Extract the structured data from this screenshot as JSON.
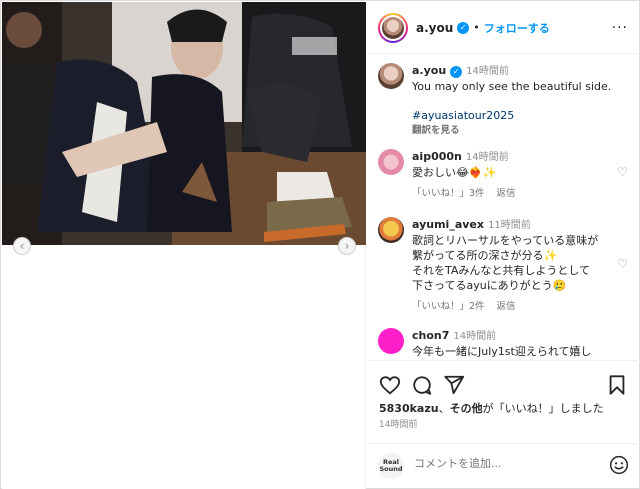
{
  "post": {
    "username": "a.you",
    "dot": "•",
    "follow_label": "フォローする",
    "more_label": "···"
  },
  "caption": {
    "username": "a.you",
    "time": "14時間前",
    "text": "You may only see the beautiful side.",
    "hashtag": "#ayuasiatour2025",
    "translate": "翻訳を見る"
  },
  "comments": [
    {
      "username": "aip000n",
      "time": "14時間前",
      "text": "愛おしい😂❤️‍🔥✨",
      "likes": "「いいね！」3件",
      "reply": "返信"
    },
    {
      "username": "ayumi_avex",
      "time": "11時間前",
      "text_lines": [
        "歌詞とリハーサルをやっている意味が",
        "繋がってる所の深さが分る✨",
        "それをTAみんなと共有しようとして",
        "下さってるayuにありがとう🥲"
      ],
      "likes": "「いいね！」2件",
      "reply": "返信"
    },
    {
      "username": "chon7",
      "time": "14時間前",
      "text": "今年も一緒にJuly1st迎えられて嬉し"
    }
  ],
  "actions": {
    "likes_user": "5830kazu",
    "likes_sep": "、",
    "likes_others": "その他",
    "likes_suffix": "が「いいね！」しました",
    "time": "14時間前"
  },
  "composer": {
    "avatar_label": "Real Sound",
    "placeholder": "コメントを追加..."
  },
  "nav": {
    "prev": "‹",
    "next": "›"
  },
  "colors": {
    "accent": "#0095f6",
    "hashtag": "#00376b",
    "muted": "#8e8e8e"
  }
}
